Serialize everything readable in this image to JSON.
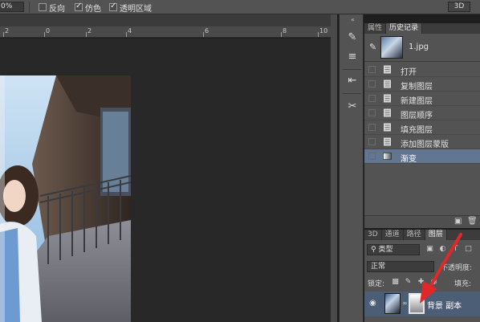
{
  "options_bar": {
    "zoom": "0%",
    "reverse": {
      "label": "反向",
      "checked": false
    },
    "dither": {
      "label": "仿色",
      "checked": true
    },
    "transparency": {
      "label": "透明区域",
      "checked": true
    },
    "mode_3d": "3D"
  },
  "ruler": {
    "labels": [
      "2",
      "0",
      "2",
      "4",
      "6",
      "8",
      "10"
    ]
  },
  "toolstrip": {
    "collapse_glyph": "«"
  },
  "history_panel": {
    "tabs": [
      "属性",
      "历史记录"
    ],
    "active_tab": "历史记录",
    "snapshot_name": "1.jpg",
    "items": [
      {
        "label": "打开",
        "icon": "document-icon",
        "selected": false
      },
      {
        "label": "复制图层",
        "icon": "document-icon",
        "selected": false
      },
      {
        "label": "新建图层",
        "icon": "document-icon",
        "selected": false
      },
      {
        "label": "图层顺序",
        "icon": "document-icon",
        "selected": false
      },
      {
        "label": "填充图层",
        "icon": "document-icon",
        "selected": false
      },
      {
        "label": "添加图层蒙版",
        "icon": "document-icon",
        "selected": false
      },
      {
        "label": "渐变",
        "icon": "gradient-icon",
        "selected": true
      }
    ]
  },
  "layers_panel": {
    "tabs": [
      "3D",
      "通道",
      "路径",
      "图层"
    ],
    "active_tab": "图层",
    "filter_label": "类型",
    "blend_mode": "正常",
    "opacity_label": "不透明度:",
    "lock_label": "锁定:",
    "fill_label": "填充:",
    "layer_name": "背景 副本"
  },
  "colors": {
    "selection": "#627591",
    "layer_selection": "#4c5d76",
    "arrow": "#e0282a"
  }
}
